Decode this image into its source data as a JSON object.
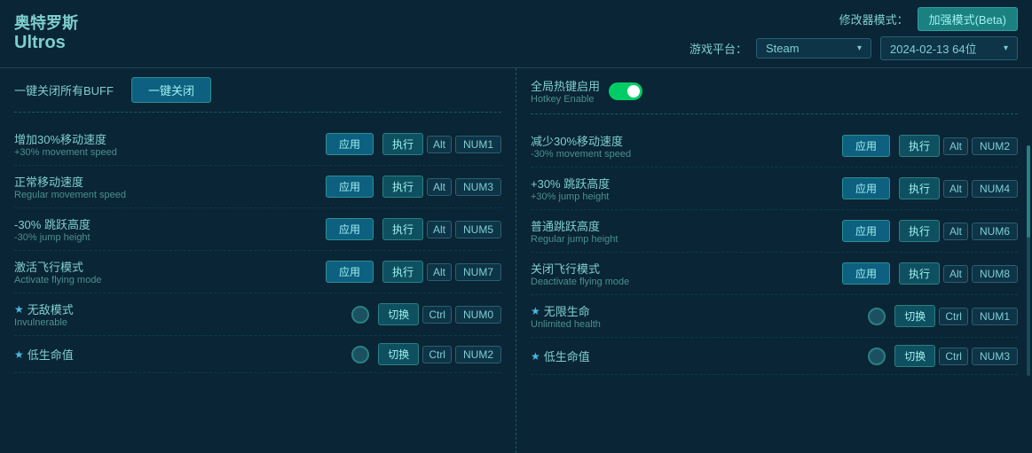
{
  "app": {
    "title_zh": "奥特罗斯",
    "title_en": "Ultros"
  },
  "header": {
    "modifier_label": "修改器模式：",
    "modifier_btn": "加强模式(Beta)",
    "platform_label": "游戏平台：",
    "platform_value": "Steam",
    "version_value": "2024-02-13 64位",
    "chevron": "▾"
  },
  "left_panel": {
    "one_click_label": "一键关闭所有BUFF",
    "one_click_btn": "一键关闭",
    "items": [
      {
        "name_zh": "增加30%移动速度",
        "name_en": "+30% movement speed",
        "has_star": false,
        "type": "apply",
        "btn_label": "应用",
        "hotkey_type": "execute",
        "execute_label": "执行",
        "key1": "Alt",
        "key2": "NUM1"
      },
      {
        "name_zh": "正常移动速度",
        "name_en": "Regular movement speed",
        "has_star": false,
        "type": "apply",
        "btn_label": "应用",
        "hotkey_type": "execute",
        "execute_label": "执行",
        "key1": "Alt",
        "key2": "NUM3"
      },
      {
        "name_zh": "-30% 跳跃高度",
        "name_en": "-30% jump height",
        "has_star": false,
        "type": "apply",
        "btn_label": "应用",
        "hotkey_type": "execute",
        "execute_label": "执行",
        "key1": "Alt",
        "key2": "NUM5"
      },
      {
        "name_zh": "激活飞行模式",
        "name_en": "Activate flying mode",
        "has_star": false,
        "type": "apply",
        "btn_label": "应用",
        "hotkey_type": "execute",
        "execute_label": "执行",
        "key1": "Alt",
        "key2": "NUM7"
      },
      {
        "name_zh": "无敌模式",
        "name_en": "Invulnerable",
        "has_star": true,
        "type": "toggle",
        "btn_label": "切换",
        "hotkey_type": "toggle",
        "execute_label": "切换",
        "key1": "Ctrl",
        "key2": "NUM0"
      },
      {
        "name_zh": "低生命值",
        "name_en": "",
        "has_star": true,
        "type": "toggle",
        "btn_label": "切换",
        "hotkey_type": "toggle",
        "execute_label": "切换",
        "key1": "Ctrl",
        "key2": "NUM2"
      }
    ]
  },
  "right_panel": {
    "hotkey_enable_zh": "全局热键启用",
    "hotkey_enable_en": "Hotkey Enable",
    "items": [
      {
        "name_zh": "减少30%移动速度",
        "name_en": "-30% movement speed",
        "has_star": false,
        "type": "apply",
        "btn_label": "应用",
        "hotkey_type": "execute",
        "execute_label": "执行",
        "key1": "Alt",
        "key2": "NUM2"
      },
      {
        "name_zh": "+30% 跳跃高度",
        "name_en": "+30% jump height",
        "has_star": false,
        "type": "apply",
        "btn_label": "应用",
        "hotkey_type": "execute",
        "execute_label": "执行",
        "key1": "Alt",
        "key2": "NUM4"
      },
      {
        "name_zh": "普通跳跃高度",
        "name_en": "Regular jump height",
        "has_star": false,
        "type": "apply",
        "btn_label": "应用",
        "hotkey_type": "execute",
        "execute_label": "执行",
        "key1": "Alt",
        "key2": "NUM6"
      },
      {
        "name_zh": "关闭飞行模式",
        "name_en": "Deactivate flying mode",
        "has_star": false,
        "type": "apply",
        "btn_label": "应用",
        "hotkey_type": "execute",
        "execute_label": "执行",
        "key1": "Alt",
        "key2": "NUM8"
      },
      {
        "name_zh": "无限生命",
        "name_en": "Unlimited health",
        "has_star": true,
        "type": "toggle",
        "btn_label": "切换",
        "hotkey_type": "toggle",
        "execute_label": "切换",
        "key1": "Ctrl",
        "key2": "NUM1"
      },
      {
        "name_zh": "低生命值",
        "name_en": "",
        "has_star": true,
        "type": "toggle",
        "btn_label": "切换",
        "hotkey_type": "toggle",
        "execute_label": "切换",
        "key1": "Ctrl",
        "key2": "NUM3"
      }
    ]
  }
}
